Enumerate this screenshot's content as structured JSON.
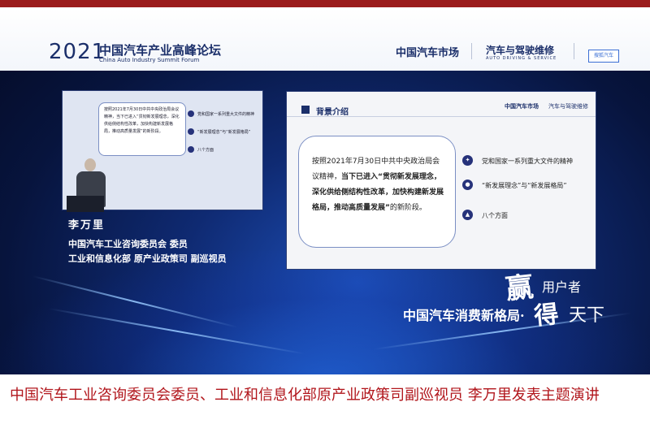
{
  "banner": {
    "year": "2021",
    "summit_cn": "中国汽车产业高峰论坛",
    "summit_en": "China Auto Industry Summit Forum",
    "logo_a": "中国汽车市场",
    "logo_b": "汽车与驾驶维修",
    "logo_b_en": "AUTO DRIVING & SERVICE",
    "logo_c": "搜狐汽车"
  },
  "left_screen": {
    "box_text": "按照2021年7月30日中共中央政治局会议精神，当下已进入“贯彻新发展理念，深化供给侧结构性改革，加快构建新发展格局，推动高质量发展”的新阶段。",
    "items": [
      "党和国家一系列重大文件的精神",
      "“新发展理念”与“新发展格局”",
      "八个方面"
    ]
  },
  "slide": {
    "header": "背景介绍",
    "logo": "中国汽车市场",
    "logo2": "汽车与驾驶维修",
    "box_plain_1": "按照2021年7月30日中共中央政治局会议精神，",
    "box_bold": "当下已进入“贯彻新发展理念，深化供给侧结构性改革，加快构建新发展格局，推动高质量发展”",
    "box_plain_2": "的新阶段。",
    "items": [
      "党和国家一系列重大文件的精神",
      "“新发展理念”与“新发展格局”",
      "八个方面"
    ]
  },
  "speaker": {
    "name": "李万里",
    "title_line_1": "中国汽车工业咨询委员会 委员",
    "title_line_2": "工业和信息化部 原产业政策司 副巡视员"
  },
  "slogan": {
    "main": "中国汽车消费新格局·",
    "big_1": "赢",
    "small_1": "用户者",
    "big_2": "得",
    "small_2": "天下"
  },
  "caption": "中国汽车工业咨询委员会委员、工业和信息化部原产业政策司副巡视员 李万里发表主题演讲"
}
